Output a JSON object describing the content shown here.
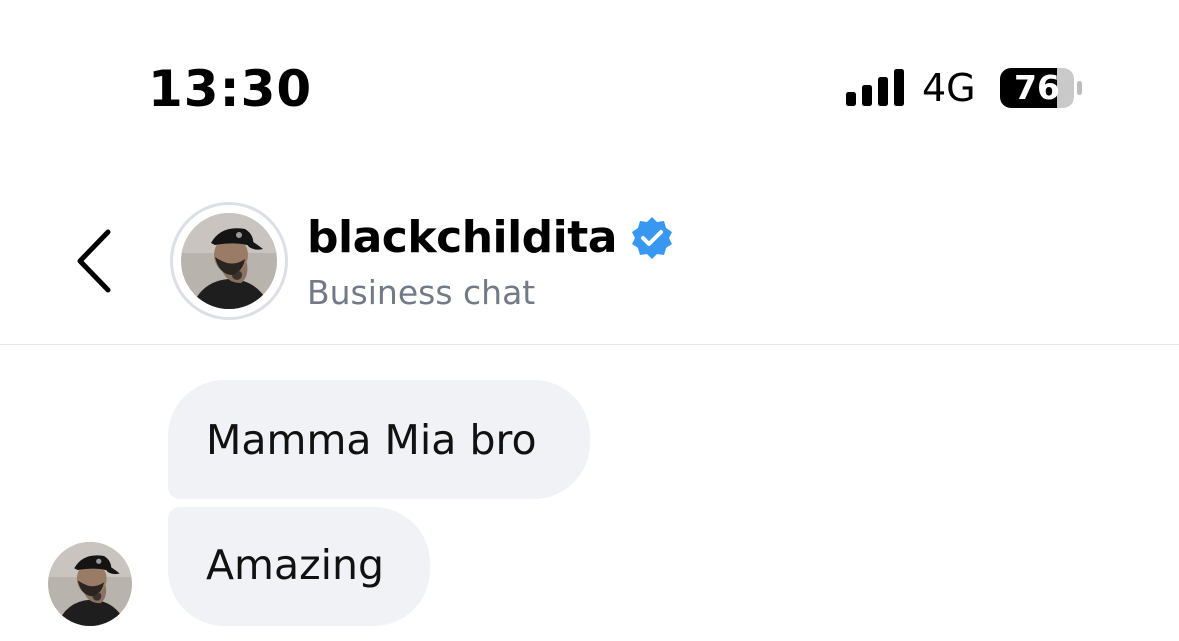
{
  "status_bar": {
    "time": "13:30",
    "network": "4G",
    "battery_level": "76",
    "signal_icon": "cellular-signal-icon",
    "battery_icon": "battery-icon"
  },
  "header": {
    "back_icon": "chevron-left-icon",
    "username": "blackchildita",
    "verified_icon": "verified-badge-icon",
    "subtitle": "Business chat",
    "colors": {
      "verified": "#3897f0",
      "subtitle": "#737a87"
    }
  },
  "messages": [
    {
      "text": "Mamma Mia bro"
    },
    {
      "text": "Amazing"
    }
  ],
  "colors": {
    "bubble_background": "#f1f2f5",
    "divider": "#e6e6e6"
  }
}
